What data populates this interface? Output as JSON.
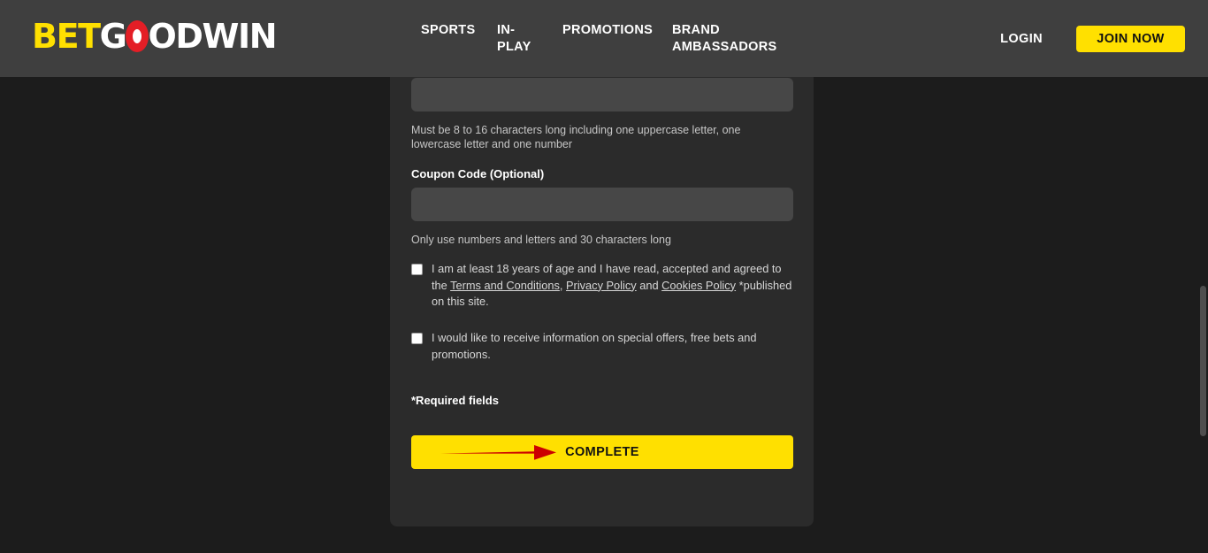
{
  "header": {
    "logo": {
      "part_yellow": "BET",
      "part_white_1": "G",
      "part_white_2": "ODWIN",
      "accent_yellow": "#ffe000",
      "accent_red": "#e41e26"
    },
    "nav_items": [
      {
        "label": "SPORTS",
        "name": "sports"
      },
      {
        "label": "IN-PLAY",
        "name": "in-play"
      },
      {
        "label": "PROMOTIONS",
        "name": "promotions"
      },
      {
        "label": "BRAND AMBASSADORS",
        "name": "brand-ambassadors"
      }
    ],
    "login_label": "LOGIN",
    "join_label": "JOIN NOW",
    "bar_color": "#3f3f3f"
  },
  "form": {
    "password": {
      "value": "",
      "placeholder": "",
      "helper": "Must be 8 to 16 characters long including one uppercase letter, one lowercase letter and one number"
    },
    "coupon": {
      "label": "Coupon Code (Optional)",
      "value": "",
      "placeholder": "",
      "helper": "Only use numbers and letters and 30 characters long"
    },
    "terms_checkbox": {
      "checked": false,
      "text_before": "I am at least 18 years of age and I have read, accepted and agreed to the ",
      "link_terms": "Terms and Conditions",
      "sep_1": ", ",
      "link_privacy": "Privacy Policy",
      "sep_2": " and ",
      "link_cookies": "Cookies Policy",
      "text_after": " *published on this site."
    },
    "marketing_checkbox": {
      "checked": false,
      "text": "I would like to receive information on special offers, free bets and promotions."
    },
    "required_note": "*Required fields",
    "submit_label": "COMPLETE"
  },
  "annotation": {
    "arrow_color": "#cc0000",
    "points_to": "COMPLETE"
  },
  "colors": {
    "page_bg": "#1c1c1c",
    "card_bg": "#2b2b2b",
    "input_bg": "#474747",
    "yellow": "#ffe000",
    "helper_text": "#c6c6c6"
  }
}
